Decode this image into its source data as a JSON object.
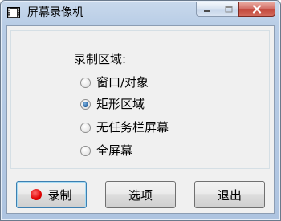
{
  "window": {
    "title": "屏幕录像机",
    "icon": "film-strip-icon"
  },
  "caption_buttons": {
    "minimize": "minimize-icon",
    "maximize": "maximize-icon",
    "close": "close-icon"
  },
  "record_area": {
    "label": "录制区域:",
    "options": [
      {
        "label": "窗口/对象",
        "checked": false
      },
      {
        "label": "矩形区域",
        "checked": true
      },
      {
        "label": "无任务栏屏幕",
        "checked": false
      },
      {
        "label": "全屏幕",
        "checked": false
      }
    ]
  },
  "buttons": {
    "record": "录制",
    "options": "选项",
    "exit": "退出"
  },
  "colors": {
    "record_dot": "#e00000",
    "close_button": "#c2463a"
  }
}
